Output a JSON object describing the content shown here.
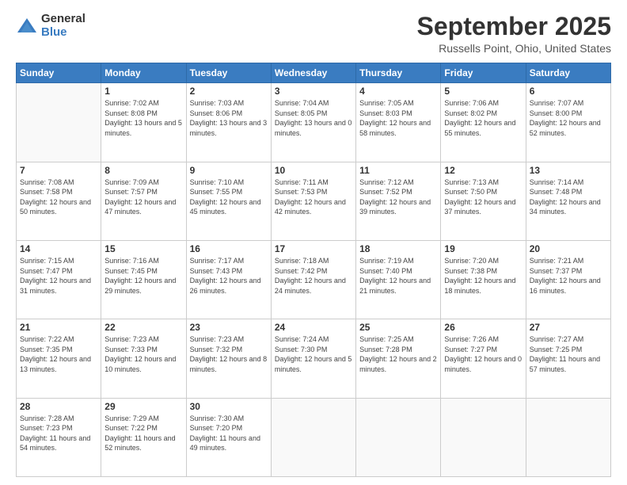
{
  "logo": {
    "general": "General",
    "blue": "Blue"
  },
  "title": "September 2025",
  "location": "Russells Point, Ohio, United States",
  "days_of_week": [
    "Sunday",
    "Monday",
    "Tuesday",
    "Wednesday",
    "Thursday",
    "Friday",
    "Saturday"
  ],
  "weeks": [
    [
      {
        "day": "",
        "empty": true
      },
      {
        "day": "1",
        "sunrise": "Sunrise: 7:02 AM",
        "sunset": "Sunset: 8:08 PM",
        "daylight": "Daylight: 13 hours and 5 minutes."
      },
      {
        "day": "2",
        "sunrise": "Sunrise: 7:03 AM",
        "sunset": "Sunset: 8:06 PM",
        "daylight": "Daylight: 13 hours and 3 minutes."
      },
      {
        "day": "3",
        "sunrise": "Sunrise: 7:04 AM",
        "sunset": "Sunset: 8:05 PM",
        "daylight": "Daylight: 13 hours and 0 minutes."
      },
      {
        "day": "4",
        "sunrise": "Sunrise: 7:05 AM",
        "sunset": "Sunset: 8:03 PM",
        "daylight": "Daylight: 12 hours and 58 minutes."
      },
      {
        "day": "5",
        "sunrise": "Sunrise: 7:06 AM",
        "sunset": "Sunset: 8:02 PM",
        "daylight": "Daylight: 12 hours and 55 minutes."
      },
      {
        "day": "6",
        "sunrise": "Sunrise: 7:07 AM",
        "sunset": "Sunset: 8:00 PM",
        "daylight": "Daylight: 12 hours and 52 minutes."
      }
    ],
    [
      {
        "day": "7",
        "sunrise": "Sunrise: 7:08 AM",
        "sunset": "Sunset: 7:58 PM",
        "daylight": "Daylight: 12 hours and 50 minutes."
      },
      {
        "day": "8",
        "sunrise": "Sunrise: 7:09 AM",
        "sunset": "Sunset: 7:57 PM",
        "daylight": "Daylight: 12 hours and 47 minutes."
      },
      {
        "day": "9",
        "sunrise": "Sunrise: 7:10 AM",
        "sunset": "Sunset: 7:55 PM",
        "daylight": "Daylight: 12 hours and 45 minutes."
      },
      {
        "day": "10",
        "sunrise": "Sunrise: 7:11 AM",
        "sunset": "Sunset: 7:53 PM",
        "daylight": "Daylight: 12 hours and 42 minutes."
      },
      {
        "day": "11",
        "sunrise": "Sunrise: 7:12 AM",
        "sunset": "Sunset: 7:52 PM",
        "daylight": "Daylight: 12 hours and 39 minutes."
      },
      {
        "day": "12",
        "sunrise": "Sunrise: 7:13 AM",
        "sunset": "Sunset: 7:50 PM",
        "daylight": "Daylight: 12 hours and 37 minutes."
      },
      {
        "day": "13",
        "sunrise": "Sunrise: 7:14 AM",
        "sunset": "Sunset: 7:48 PM",
        "daylight": "Daylight: 12 hours and 34 minutes."
      }
    ],
    [
      {
        "day": "14",
        "sunrise": "Sunrise: 7:15 AM",
        "sunset": "Sunset: 7:47 PM",
        "daylight": "Daylight: 12 hours and 31 minutes."
      },
      {
        "day": "15",
        "sunrise": "Sunrise: 7:16 AM",
        "sunset": "Sunset: 7:45 PM",
        "daylight": "Daylight: 12 hours and 29 minutes."
      },
      {
        "day": "16",
        "sunrise": "Sunrise: 7:17 AM",
        "sunset": "Sunset: 7:43 PM",
        "daylight": "Daylight: 12 hours and 26 minutes."
      },
      {
        "day": "17",
        "sunrise": "Sunrise: 7:18 AM",
        "sunset": "Sunset: 7:42 PM",
        "daylight": "Daylight: 12 hours and 24 minutes."
      },
      {
        "day": "18",
        "sunrise": "Sunrise: 7:19 AM",
        "sunset": "Sunset: 7:40 PM",
        "daylight": "Daylight: 12 hours and 21 minutes."
      },
      {
        "day": "19",
        "sunrise": "Sunrise: 7:20 AM",
        "sunset": "Sunset: 7:38 PM",
        "daylight": "Daylight: 12 hours and 18 minutes."
      },
      {
        "day": "20",
        "sunrise": "Sunrise: 7:21 AM",
        "sunset": "Sunset: 7:37 PM",
        "daylight": "Daylight: 12 hours and 16 minutes."
      }
    ],
    [
      {
        "day": "21",
        "sunrise": "Sunrise: 7:22 AM",
        "sunset": "Sunset: 7:35 PM",
        "daylight": "Daylight: 12 hours and 13 minutes."
      },
      {
        "day": "22",
        "sunrise": "Sunrise: 7:23 AM",
        "sunset": "Sunset: 7:33 PM",
        "daylight": "Daylight: 12 hours and 10 minutes."
      },
      {
        "day": "23",
        "sunrise": "Sunrise: 7:23 AM",
        "sunset": "Sunset: 7:32 PM",
        "daylight": "Daylight: 12 hours and 8 minutes."
      },
      {
        "day": "24",
        "sunrise": "Sunrise: 7:24 AM",
        "sunset": "Sunset: 7:30 PM",
        "daylight": "Daylight: 12 hours and 5 minutes."
      },
      {
        "day": "25",
        "sunrise": "Sunrise: 7:25 AM",
        "sunset": "Sunset: 7:28 PM",
        "daylight": "Daylight: 12 hours and 2 minutes."
      },
      {
        "day": "26",
        "sunrise": "Sunrise: 7:26 AM",
        "sunset": "Sunset: 7:27 PM",
        "daylight": "Daylight: 12 hours and 0 minutes."
      },
      {
        "day": "27",
        "sunrise": "Sunrise: 7:27 AM",
        "sunset": "Sunset: 7:25 PM",
        "daylight": "Daylight: 11 hours and 57 minutes."
      }
    ],
    [
      {
        "day": "28",
        "sunrise": "Sunrise: 7:28 AM",
        "sunset": "Sunset: 7:23 PM",
        "daylight": "Daylight: 11 hours and 54 minutes."
      },
      {
        "day": "29",
        "sunrise": "Sunrise: 7:29 AM",
        "sunset": "Sunset: 7:22 PM",
        "daylight": "Daylight: 11 hours and 52 minutes."
      },
      {
        "day": "30",
        "sunrise": "Sunrise: 7:30 AM",
        "sunset": "Sunset: 7:20 PM",
        "daylight": "Daylight: 11 hours and 49 minutes."
      },
      {
        "day": "",
        "empty": true
      },
      {
        "day": "",
        "empty": true
      },
      {
        "day": "",
        "empty": true
      },
      {
        "day": "",
        "empty": true
      }
    ]
  ]
}
